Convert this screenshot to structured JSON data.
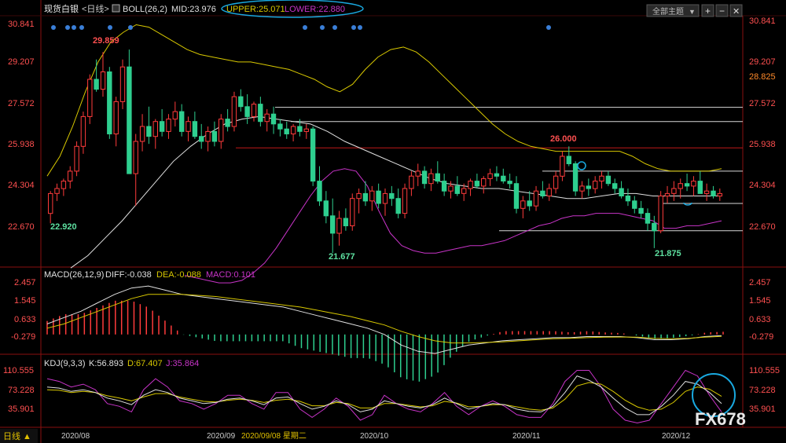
{
  "header": {
    "instrument": "现货白银",
    "period": "<日线>",
    "indicator_name": "BOLL(26,2)",
    "mid_label": "MID:23.976",
    "upper_label": "UPPER:25.071",
    "lower_label": "LOWER:22.880",
    "theme_select": "全部主题",
    "theme_arrow": "▼",
    "btn_plus": "+",
    "btn_minus": "−",
    "btn_left": "◀",
    "btn_right": "▶",
    "btn_close": "✕"
  },
  "price_axis": {
    "ticks": [
      "30.841",
      "29.207",
      "27.572",
      "25.938",
      "24.304",
      "22.670"
    ],
    "current_price": "28.825"
  },
  "annotations": {
    "high1": "29.859",
    "low1": "22.920",
    "low2": "21.677",
    "high2": "26.000",
    "low3": "21.875"
  },
  "macd": {
    "title": "MACD(26,12,9)",
    "diff_label": "DIFF:-0.038",
    "dea_label": "DEA:-0.088",
    "macd_label": "MACD:0.101",
    "ticks": [
      "2.457",
      "1.545",
      "0.633",
      "-0.279"
    ]
  },
  "kdj": {
    "title": "KDJ(9,3,3)",
    "k_label": "K:56.893",
    "d_label": "D:67.407",
    "j_label": "J:35.864",
    "ticks": [
      "110.555",
      "73.228",
      "35.901"
    ]
  },
  "bottom": {
    "period_button": "日线 ▲",
    "months": [
      "2020/08",
      "2020/09",
      "2020/10",
      "2020/11",
      "2020/12"
    ],
    "cursor_date": "2020/09/08 星期二"
  },
  "watermark": "FX678",
  "colors": {
    "up": "#ff3b3b",
    "down": "#2ecf8f",
    "upper_band": "#d8c800",
    "lower_band": "#c834c8",
    "mid_band": "#e0e0e0",
    "axis_text_red": "#ff5050",
    "highlight_circle": "#19a9e0"
  },
  "chart_data": {
    "type": "candlestick",
    "title": "现货白银",
    "ylim": [
      21.2,
      31.2
    ],
    "candles": [
      [
        23.3,
        24.2,
        22.9,
        24.1
      ],
      [
        24.1,
        24.5,
        23.8,
        24.3
      ],
      [
        24.3,
        24.7,
        24.0,
        24.6
      ],
      [
        24.6,
        25.2,
        24.3,
        25.0
      ],
      [
        25.0,
        26.2,
        24.8,
        26.0
      ],
      [
        26.0,
        27.4,
        25.7,
        27.2
      ],
      [
        27.2,
        28.9,
        26.9,
        28.7
      ],
      [
        28.7,
        29.5,
        28.2,
        28.3
      ],
      [
        28.3,
        29.8,
        28.0,
        29.0
      ],
      [
        29.0,
        29.2,
        26.3,
        26.5
      ],
      [
        26.5,
        28.0,
        26.0,
        27.8
      ],
      [
        27.8,
        29.5,
        27.5,
        29.2
      ],
      [
        29.2,
        29.9,
        28.5,
        24.9
      ],
      [
        24.9,
        26.5,
        23.6,
        26.2
      ],
      [
        26.2,
        27.3,
        25.8,
        26.8
      ],
      [
        26.8,
        27.6,
        26.1,
        26.4
      ],
      [
        26.4,
        27.1,
        25.9,
        27.0
      ],
      [
        27.0,
        27.5,
        26.4,
        26.6
      ],
      [
        26.6,
        27.3,
        26.3,
        27.1
      ],
      [
        27.1,
        27.8,
        26.8,
        27.4
      ],
      [
        27.4,
        27.7,
        26.4,
        26.6
      ],
      [
        26.6,
        27.2,
        26.2,
        27.0
      ],
      [
        27.0,
        27.4,
        26.3,
        26.4
      ],
      [
        26.4,
        26.9,
        25.9,
        26.2
      ],
      [
        26.2,
        26.8,
        25.8,
        26.6
      ],
      [
        26.6,
        27.0,
        26.0,
        26.2
      ],
      [
        26.2,
        27.3,
        25.9,
        27.1
      ],
      [
        27.1,
        27.5,
        26.6,
        26.8
      ],
      [
        26.8,
        28.2,
        26.6,
        28.0
      ],
      [
        28.0,
        28.3,
        27.4,
        27.6
      ],
      [
        27.6,
        28.1,
        26.9,
        27.2
      ],
      [
        27.2,
        27.8,
        27.0,
        27.7
      ],
      [
        27.7,
        28.0,
        26.8,
        27.0
      ],
      [
        27.0,
        27.5,
        26.6,
        27.3
      ],
      [
        27.3,
        27.6,
        26.5,
        26.9
      ],
      [
        26.9,
        27.1,
        26.4,
        26.7
      ],
      [
        26.7,
        27.0,
        26.3,
        26.5
      ],
      [
        26.5,
        26.9,
        26.2,
        26.8
      ],
      [
        26.8,
        27.1,
        26.4,
        26.6
      ],
      [
        26.6,
        26.9,
        26.3,
        26.7
      ],
      [
        26.7,
        26.8,
        24.4,
        24.6
      ],
      [
        24.6,
        25.2,
        23.6,
        23.8
      ],
      [
        23.8,
        24.2,
        22.9,
        23.2
      ],
      [
        23.2,
        23.9,
        21.7,
        22.5
      ],
      [
        22.5,
        23.4,
        22.0,
        23.1
      ],
      [
        23.1,
        23.5,
        22.6,
        22.8
      ],
      [
        22.8,
        24.1,
        22.6,
        23.9
      ],
      [
        23.9,
        24.3,
        23.3,
        24.1
      ],
      [
        24.1,
        24.6,
        23.6,
        23.8
      ],
      [
        23.8,
        24.4,
        23.4,
        24.2
      ],
      [
        24.2,
        24.5,
        23.5,
        23.7
      ],
      [
        23.7,
        24.3,
        23.2,
        24.1
      ],
      [
        24.1,
        24.4,
        23.6,
        23.9
      ],
      [
        23.9,
        24.3,
        23.1,
        23.3
      ],
      [
        23.3,
        24.5,
        23.1,
        24.3
      ],
      [
        24.3,
        25.0,
        24.0,
        24.8
      ],
      [
        24.8,
        25.3,
        24.4,
        25.0
      ],
      [
        25.0,
        25.2,
        24.3,
        24.5
      ],
      [
        24.5,
        25.1,
        24.2,
        24.9
      ],
      [
        24.9,
        25.4,
        24.5,
        24.6
      ],
      [
        24.6,
        24.9,
        24.0,
        24.2
      ],
      [
        24.2,
        24.6,
        23.9,
        24.4
      ],
      [
        24.4,
        24.8,
        24.0,
        24.1
      ],
      [
        24.1,
        24.5,
        23.8,
        24.3
      ],
      [
        24.3,
        24.7,
        24.0,
        24.6
      ],
      [
        24.6,
        24.9,
        24.3,
        24.4
      ],
      [
        24.4,
        24.8,
        24.1,
        24.7
      ],
      [
        24.7,
        25.1,
        24.4,
        24.9
      ],
      [
        24.9,
        25.2,
        24.6,
        24.8
      ],
      [
        24.8,
        25.1,
        24.5,
        24.6
      ],
      [
        24.6,
        24.9,
        24.3,
        24.5
      ],
      [
        24.5,
        24.8,
        23.3,
        23.5
      ],
      [
        23.5,
        24.0,
        23.1,
        23.8
      ],
      [
        23.8,
        24.2,
        23.4,
        23.6
      ],
      [
        23.6,
        24.4,
        23.4,
        24.2
      ],
      [
        24.2,
        24.6,
        23.9,
        24.0
      ],
      [
        24.0,
        24.5,
        23.8,
        24.3
      ],
      [
        24.3,
        25.0,
        24.1,
        24.8
      ],
      [
        24.8,
        25.8,
        24.6,
        25.6
      ],
      [
        25.6,
        26.0,
        25.2,
        25.3
      ],
      [
        25.3,
        25.4,
        24.0,
        24.2
      ],
      [
        24.2,
        24.6,
        23.9,
        24.4
      ],
      [
        24.4,
        24.7,
        24.0,
        24.3
      ],
      [
        24.3,
        24.8,
        24.1,
        24.6
      ],
      [
        24.6,
        25.0,
        24.3,
        24.8
      ],
      [
        24.8,
        25.0,
        24.4,
        24.5
      ],
      [
        24.5,
        24.7,
        24.1,
        24.3
      ],
      [
        24.3,
        24.6,
        23.9,
        24.0
      ],
      [
        24.0,
        24.3,
        23.6,
        23.8
      ],
      [
        23.8,
        24.0,
        23.3,
        23.5
      ],
      [
        23.5,
        23.8,
        23.1,
        23.3
      ],
      [
        23.3,
        23.5,
        22.6,
        22.9
      ],
      [
        22.9,
        23.2,
        21.9,
        22.6
      ],
      [
        22.6,
        24.2,
        22.5,
        24.0
      ],
      [
        24.0,
        24.4,
        23.7,
        24.1
      ],
      [
        24.1,
        24.6,
        23.8,
        24.3
      ],
      [
        24.3,
        24.7,
        23.9,
        24.5
      ],
      [
        24.5,
        24.9,
        24.2,
        24.4
      ],
      [
        24.4,
        24.8,
        24.0,
        24.6
      ],
      [
        24.6,
        25.0,
        24.3,
        24.1
      ],
      [
        24.1,
        24.5,
        23.8,
        24.2
      ],
      [
        24.2,
        24.4,
        23.9,
        24.0
      ],
      [
        24.0,
        24.3,
        23.8,
        24.1
      ]
    ],
    "upper_band": [
      24.8,
      25.6,
      26.8,
      28.2,
      29.4,
      30.2,
      30.6,
      30.9,
      30.8,
      30.5,
      30.2,
      29.9,
      29.7,
      29.6,
      29.5,
      29.4,
      29.4,
      29.3,
      29.2,
      29.1,
      28.9,
      28.7,
      28.4,
      28.2,
      28.5,
      29.1,
      29.6,
      29.9,
      30.0,
      29.8,
      29.4,
      28.9,
      28.4,
      27.9,
      27.4,
      26.9,
      26.5,
      26.2,
      26.0,
      25.9,
      25.8,
      25.8,
      25.8,
      25.8,
      25.8,
      25.8,
      25.6,
      25.3,
      25.1,
      25.0,
      25.0,
      25.0,
      25.0,
      25.1
    ],
    "lower_band": [
      20.8,
      20.7,
      20.6,
      20.5,
      20.5,
      20.6,
      20.9,
      21.3,
      21.9,
      22.6,
      23.3,
      24.0,
      24.6,
      25.0,
      25.1,
      25.0,
      24.4,
      23.4,
      22.5,
      22.0,
      21.8,
      21.7,
      21.7,
      21.8,
      21.9,
      22.0,
      22.0,
      22.1,
      22.2,
      22.4,
      22.6,
      22.8,
      22.9,
      23.1,
      23.2,
      23.2,
      23.3,
      23.3,
      23.3,
      23.2,
      23.1,
      23.0,
      22.7,
      22.7,
      22.8,
      22.8,
      22.9,
      23.0
    ],
    "mid_band": [
      21.1,
      21.6,
      22.3,
      23.0,
      23.8,
      24.6,
      25.4,
      26.0,
      26.5,
      26.9,
      27.1,
      27.2,
      27.1,
      27.0,
      26.9,
      26.6,
      26.2,
      25.9,
      25.6,
      25.3,
      25.0,
      24.7,
      24.5,
      24.4,
      24.3,
      24.3,
      24.2,
      24.1,
      24.0,
      23.9,
      23.9,
      24.0,
      24.1,
      24.1,
      24.0,
      24.0,
      24.0,
      24.0,
      24.0
    ],
    "horizontal_levels": [
      27.572,
      27.0,
      25.938,
      25.0,
      23.7,
      22.6
    ],
    "macd_series": {
      "diff": [
        0.5,
        0.8,
        1.1,
        1.5,
        1.9,
        2.2,
        2.3,
        2.1,
        1.9,
        1.8,
        1.7,
        1.6,
        1.5,
        1.4,
        1.3,
        1.1,
        0.9,
        0.7,
        0.5,
        0.3,
        0.0,
        -0.5,
        -0.8,
        -0.9,
        -0.7,
        -0.5,
        -0.4,
        -0.3,
        -0.25,
        -0.2,
        -0.15,
        -0.15,
        -0.1,
        -0.1,
        -0.1,
        -0.15,
        -0.25,
        -0.25,
        -0.2,
        -0.1,
        -0.05
      ],
      "dea": [
        0.3,
        0.5,
        0.8,
        1.1,
        1.4,
        1.7,
        1.9,
        1.9,
        1.9,
        1.85,
        1.8,
        1.7,
        1.6,
        1.5,
        1.4,
        1.3,
        1.15,
        1.0,
        0.85,
        0.65,
        0.45,
        0.15,
        -0.1,
        -0.3,
        -0.4,
        -0.4,
        -0.38,
        -0.35,
        -0.3,
        -0.25,
        -0.2,
        -0.18,
        -0.15,
        -0.13,
        -0.12,
        -0.13,
        -0.18,
        -0.2,
        -0.18,
        -0.13,
        -0.09
      ]
    },
    "kdj_series": {
      "k": [
        80,
        78,
        72,
        75,
        70,
        60,
        55,
        48,
        65,
        75,
        70,
        60,
        55,
        50,
        52,
        58,
        60,
        55,
        48,
        60,
        62,
        50,
        40,
        45,
        55,
        48,
        35,
        40,
        55,
        50,
        45,
        42,
        48,
        60,
        50,
        40,
        45,
        50,
        48,
        40,
        36,
        35,
        45,
        70,
        100,
        92,
        80,
        60,
        42,
        30,
        30,
        45,
        65,
        90,
        85,
        70,
        50
      ],
      "d": [
        75,
        74,
        70,
        72,
        70,
        64,
        60,
        55,
        62,
        68,
        68,
        62,
        58,
        54,
        53,
        56,
        58,
        56,
        52,
        56,
        58,
        54,
        46,
        46,
        52,
        50,
        42,
        42,
        50,
        50,
        47,
        44,
        46,
        54,
        51,
        44,
        45,
        48,
        48,
        44,
        40,
        38,
        42,
        58,
        82,
        88,
        85,
        72,
        56,
        44,
        38,
        40,
        52,
        72,
        80,
        76,
        63
      ],
      "j": [
        95,
        90,
        80,
        85,
        75,
        50,
        45,
        35,
        75,
        95,
        80,
        55,
        50,
        40,
        50,
        65,
        65,
        50,
        40,
        70,
        70,
        40,
        25,
        40,
        60,
        45,
        20,
        30,
        65,
        50,
        40,
        35,
        50,
        70,
        45,
        30,
        45,
        55,
        45,
        30,
        25,
        25,
        50,
        90,
        110,
        110,
        80,
        40,
        20,
        15,
        20,
        50,
        80,
        110,
        100,
        65,
        35
      ]
    }
  }
}
